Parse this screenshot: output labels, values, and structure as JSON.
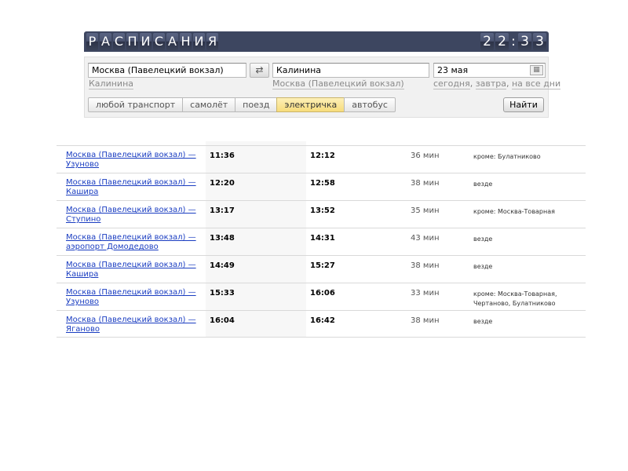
{
  "header": {
    "title_letters": [
      "Р",
      "А",
      "С",
      "П",
      "И",
      "С",
      "А",
      "Н",
      "И",
      "Я"
    ],
    "clock": {
      "h1": "2",
      "h2": "2",
      "colon": ":",
      "m1": "3",
      "m2": "3"
    }
  },
  "search": {
    "from_value": "Москва (Павелецкий вокзал)",
    "to_value": "Калинина",
    "date_value": "23 мая",
    "swap_icon": "⇄",
    "calendar_icon": "▦",
    "from_hint": "Калинина",
    "to_hint": "Москва (Павелецкий вокзал)",
    "date_hints": {
      "today": "сегодня",
      "tomorrow": "завтра",
      "all_days": "на все дни",
      "sep": ","
    },
    "transport_tabs": [
      "любой транспорт",
      "самолёт",
      "поезд",
      "электричка",
      "автобус"
    ],
    "active_tab": "электричка",
    "find_label": "Найти"
  },
  "results": [
    {
      "route": "Москва (Павелецкий вокзал) — Узуново",
      "dep": "11:36",
      "arr": "12:12",
      "dur": "36 мин",
      "days": "кроме: Булатниково"
    },
    {
      "route": "Москва (Павелецкий вокзал) — Кашира",
      "dep": "12:20",
      "arr": "12:58",
      "dur": "38 мин",
      "days": "везде"
    },
    {
      "route": "Москва (Павелецкий вокзал) — Ступино",
      "dep": "13:17",
      "arr": "13:52",
      "dur": "35 мин",
      "days": "кроме: Москва-Товарная"
    },
    {
      "route": "Москва (Павелецкий вокзал) — аэропорт Домодедово",
      "dep": "13:48",
      "arr": "14:31",
      "dur": "43 мин",
      "days": "везде"
    },
    {
      "route": "Москва (Павелецкий вокзал) — Кашира",
      "dep": "14:49",
      "arr": "15:27",
      "dur": "38 мин",
      "days": "везде"
    },
    {
      "route": "Москва (Павелецкий вокзал) — Узуново",
      "dep": "15:33",
      "arr": "16:06",
      "dur": "33 мин",
      "days": "кроме: Москва-Товарная, Чертаново, Булатниково"
    },
    {
      "route": "Москва (Павелецкий вокзал) — Яганово",
      "dep": "16:04",
      "arr": "16:42",
      "dur": "38 мин",
      "days": "везде"
    }
  ]
}
